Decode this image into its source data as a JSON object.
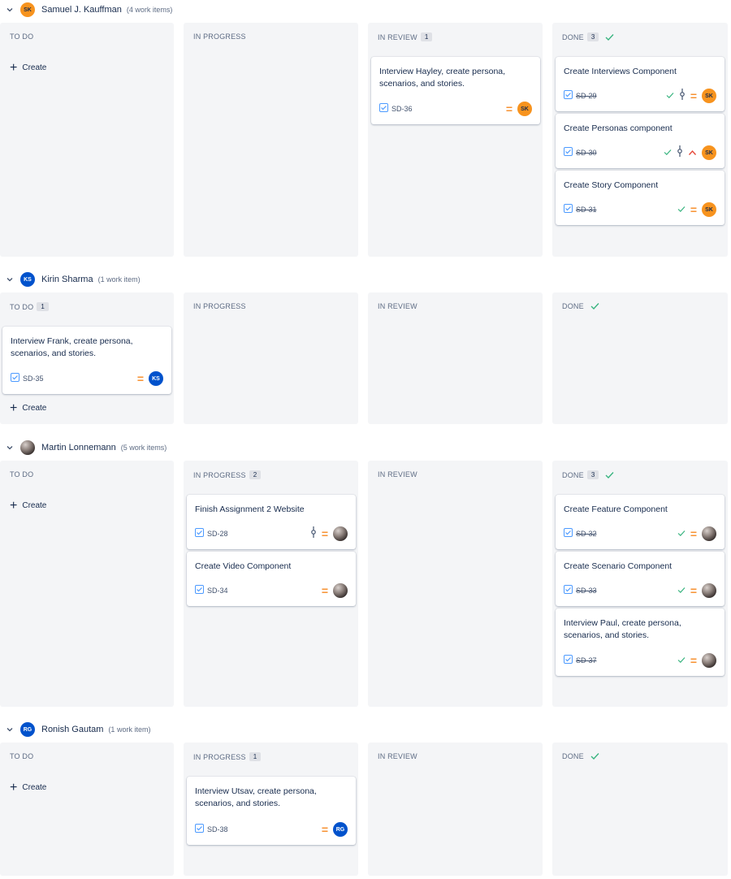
{
  "colors": {
    "accent": "#0052cc",
    "done_check": "#36b37e",
    "priority_medium": "#f79232",
    "priority_high": "#e5493a"
  },
  "columns": {
    "todo": "TO DO",
    "inprogress": "IN PROGRESS",
    "inreview": "IN REVIEW",
    "done": "DONE"
  },
  "create_label": "Create",
  "lanes": [
    {
      "name": "Samuel J. Kauffman",
      "count": "(4 work items)",
      "initials": "SK",
      "counts": {
        "inreview": "1",
        "done": "3"
      },
      "cards": {
        "inreview": [
          {
            "title": "Interview Hayley, create persona, scenarios, and stories.",
            "key": "SD-36",
            "initials": "SK"
          }
        ],
        "done": [
          {
            "title": "Create Interviews Component",
            "key": "SD-29",
            "initials": "SK"
          },
          {
            "title": "Create Personas component",
            "key": "SD-30",
            "initials": "SK"
          },
          {
            "title": "Create Story Component",
            "key": "SD-31",
            "initials": "SK"
          }
        ]
      }
    },
    {
      "name": "Kirin Sharma",
      "count": "(1 work item)",
      "initials": "KS",
      "counts": {
        "todo": "1"
      },
      "cards": {
        "todo": [
          {
            "title": "Interview Frank, create persona, scenarios, and stories.",
            "key": "SD-35",
            "initials": "KS"
          }
        ]
      }
    },
    {
      "name": "Martin Lonnemann",
      "count": "(5 work items)",
      "counts": {
        "inprogress": "2",
        "done": "3"
      },
      "cards": {
        "inprogress": [
          {
            "title": "Finish Assignment 2 Website",
            "key": "SD-28"
          },
          {
            "title": "Create Video Component",
            "key": "SD-34"
          }
        ],
        "done": [
          {
            "title": "Create Feature Component",
            "key": "SD-32"
          },
          {
            "title": "Create Scenario Component",
            "key": "SD-33"
          },
          {
            "title": "Interview Paul, create persona, scenarios, and stories.",
            "key": "SD-37"
          }
        ]
      }
    },
    {
      "name": "Ronish Gautam",
      "count": "(1 work item)",
      "initials": "RG",
      "counts": {
        "inprogress": "1"
      },
      "cards": {
        "inprogress": [
          {
            "title": "Interview Utsav, create persona, scenarios, and stories.",
            "key": "SD-38",
            "initials": "RG"
          }
        ]
      }
    }
  ]
}
